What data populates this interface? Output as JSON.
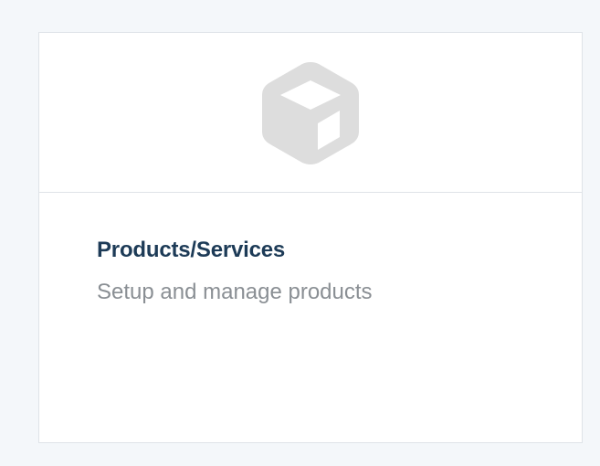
{
  "card": {
    "icon": "box-icon",
    "title": "Products/Services",
    "description": "Setup and manage products"
  },
  "colors": {
    "page_background": "#f4f7fa",
    "card_border": "#dfe3e8",
    "icon": "#dddddd",
    "title": "#1d3b57",
    "description": "#8a8f94"
  }
}
